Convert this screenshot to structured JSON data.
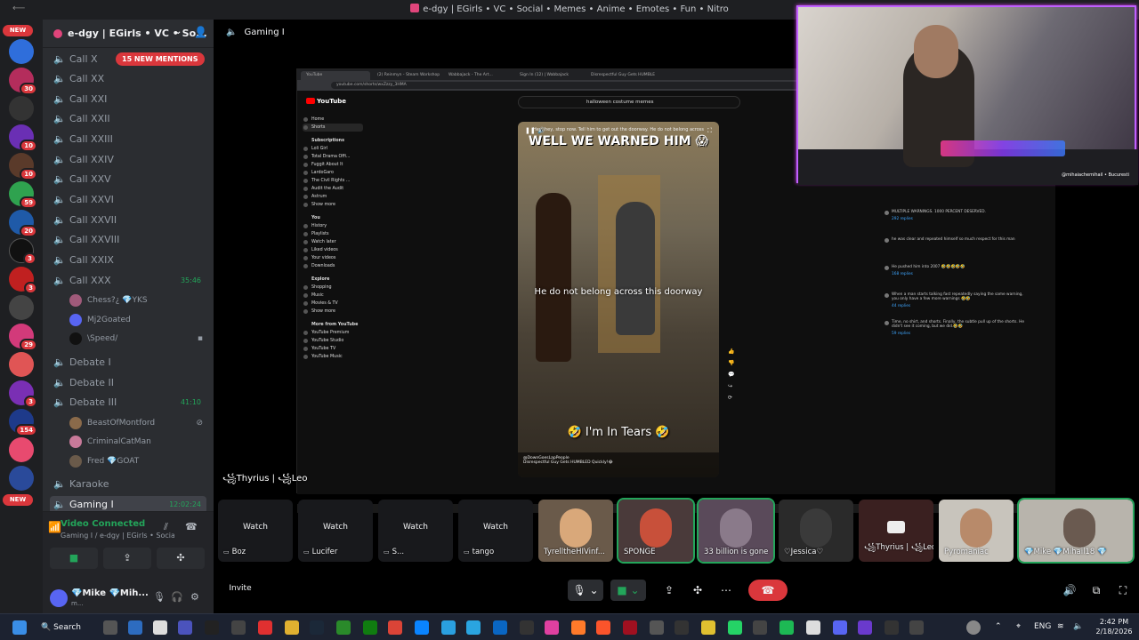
{
  "window": {
    "title": "e-dgy | EGirls • VC • Social • Memes • Anime • Emotes • Fun • Nitro",
    "back": "⟵"
  },
  "guilds": {
    "badges": [
      "NEW",
      "30",
      "10",
      "10",
      "59",
      "20",
      "3",
      "3",
      "29",
      "3",
      "154",
      "NEW"
    ]
  },
  "server": {
    "name": "e-dgy | EGirls • VC • So..."
  },
  "mentions_pill": "15 NEW MENTIONS",
  "channels": [
    {
      "name": "Call X"
    },
    {
      "name": "Call XX"
    },
    {
      "name": "Call XXI"
    },
    {
      "name": "Call XXII"
    },
    {
      "name": "Call XXIII"
    },
    {
      "name": "Call XXIV"
    },
    {
      "name": "Call XXV"
    },
    {
      "name": "Call XXVI"
    },
    {
      "name": "Call XXVII"
    },
    {
      "name": "Call XXVIII"
    },
    {
      "name": "Call XXIX"
    },
    {
      "name": "Call XXX",
      "time": "35:46"
    }
  ],
  "call_xxx_users": [
    {
      "name": "Chess?¿ 💎YKS"
    },
    {
      "name": "Mj2Goated"
    },
    {
      "name": "\\Speed/"
    }
  ],
  "debates": [
    {
      "name": "Debate I"
    },
    {
      "name": "Debate II"
    },
    {
      "name": "Debate III",
      "time": "41:10"
    }
  ],
  "debate3_users": [
    {
      "name": "BeastOfMontford"
    },
    {
      "name": "CriminalCatMan"
    },
    {
      "name": "Fred 💎GOAT"
    }
  ],
  "karaoke": "Karaoke",
  "active_channel": {
    "name": "Gaming I",
    "time": "12:02:24"
  },
  "voice": {
    "status": "Video Connected",
    "sub": "Gaming I / e-dgy | EGirls • Social..."
  },
  "user": {
    "name": "💎Mike 💎Mih...",
    "status": "m..."
  },
  "stage": {
    "title": "Gaming I",
    "invite": "Invite"
  },
  "stream": {
    "tabs": [
      "YouTube",
      "(2) Reinmyn - Steam Workshop",
      "Wabbajack - The Art...",
      "Sign In (12) | Wabbajack",
      "Disrespectful Guy Gets HUMBLED"
    ],
    "url": "youtube.com/shorts/wxZzzy_3HMA",
    "yt_logo": "YouTube",
    "search": "halloween costume memes",
    "side_main": [
      "Home",
      "Shorts"
    ],
    "subs_title": "Subscriptions",
    "subs": [
      "Loli Girl",
      "Total Drama Offi...",
      "Fuggit About It",
      "LardoGaro",
      "The Civil Rights ...",
      "Audit the Audit",
      "Astrum",
      "Show more"
    ],
    "you_title": "You",
    "you": [
      "History",
      "Playlists",
      "Watch later",
      "Liked videos",
      "Your videos",
      "Downloads"
    ],
    "explore_title": "Explore",
    "explore": [
      "Shopping",
      "Music",
      "Movies & TV",
      "Show more"
    ],
    "more_title": "More from YouTube",
    "more": [
      "YouTube Premium",
      "YouTube Studio",
      "YouTube TV",
      "YouTube Music"
    ],
    "short_top": "WELL WE WARNED HIM 😱",
    "short_sub": "Hey, hey, stop now. Tell him to get out the doorway. He do not belong across",
    "short_caption": "He do not belong across this doorway",
    "short_bottom": "🤣 I'm In Tears 🤣",
    "short_channel": "@DownGoesLapPeople",
    "short_title": "Disrespectful Guy Gets HUMBLED Quickly!😂",
    "comments": [
      {
        "text": "MULTIPLE WARNINGS. 1000 PERCENT DESERVED.",
        "replies": "292 replies"
      },
      {
        "text": "he was clear and repeated himself so much respect for this man",
        "replies": ""
      },
      {
        "text": "He pushed him into 2007 🤣🤣🤣🤣🤣",
        "replies": "168 replies"
      },
      {
        "text": "When a man starts talking fast repeatedly saying the same warning, you only have a few more warnings 🤣🤣",
        "replies": "44 replies"
      },
      {
        "text": "Time, no shirt, and shorts. Finally, the subtle pull up of the shorts. He didn't see it coming, but we did.🤣🤣",
        "replies": "59 replies"
      }
    ],
    "viewer_name": "꧁Thyrius | ꧁Leo"
  },
  "cam_credit": "@mihaiachemihail • Bucuresti",
  "tiles": [
    {
      "label": "Watch",
      "name": "Boz",
      "type": "watch"
    },
    {
      "label": "Watch",
      "name": "Lucifer",
      "type": "watch"
    },
    {
      "label": "Watch",
      "name": "S...",
      "type": "watch"
    },
    {
      "label": "Watch",
      "name": "tango",
      "type": "watch"
    },
    {
      "name": "TyrelltheHIVinf...",
      "type": "video"
    },
    {
      "name": "SPONGE",
      "type": "video"
    },
    {
      "name": "33 billion is gone",
      "type": "video"
    },
    {
      "name": "♡Jessica♡",
      "type": "video"
    },
    {
      "name": "꧁Thyrius | ꧁Leo",
      "type": "video"
    },
    {
      "name": "Pyromaniac",
      "type": "video"
    },
    {
      "name": "💎Mike 💎Mihail18 💎",
      "type": "video"
    }
  ],
  "taskbar": {
    "search": "Search",
    "lang": "ENG",
    "time": "2:42 PM",
    "date": "2/18/2026"
  }
}
